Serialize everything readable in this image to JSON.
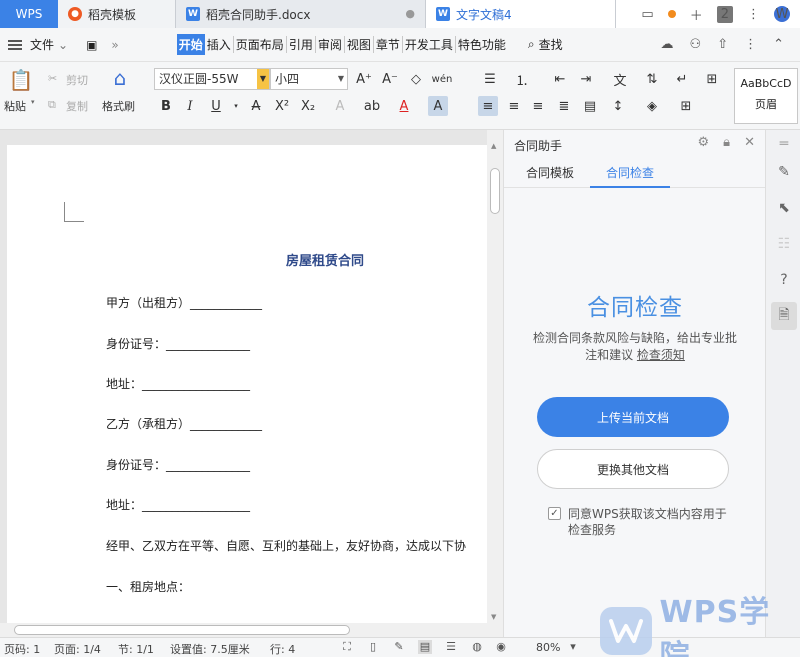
{
  "tabbar": {
    "app": "WPS",
    "tabs": [
      {
        "label": "稻壳模板",
        "icon": "docer-icon"
      },
      {
        "label": "稻壳合同助手.docx",
        "icon": "word-doc-icon"
      },
      {
        "label": "文字文稿4",
        "icon": "word-doc-icon"
      }
    ],
    "window_count": "2"
  },
  "menu": {
    "file": "文件",
    "tabs": [
      "开始",
      "插入",
      "页面布局",
      "引用",
      "审阅",
      "视图",
      "章节",
      "开发工具",
      "特色功能"
    ],
    "search": "查找"
  },
  "ribbon": {
    "paste": "粘贴",
    "cut": "剪切",
    "copy": "复制",
    "format_painter": "格式刷",
    "font_name": "汉仪正圆-55W",
    "font_size": "小四",
    "style_preview": "AaBbCcD",
    "style_name": "页眉"
  },
  "document": {
    "title": "房屋租赁合同",
    "lines": [
      "甲方（出租方）____________",
      "身份证号：______________",
      "地址：__________________",
      "乙方（承租方）____________",
      "身份证号：______________",
      "地址：__________________",
      "经甲、乙双方在平等、自愿、互利的基础上，友好协商，达成以下协",
      "一、租房地点："
    ]
  },
  "panel": {
    "header": "合同助手",
    "tabs": [
      "合同模板",
      "合同检查"
    ],
    "active_tab": "合同检查",
    "heading": "合同检查",
    "description": "检测合同条款风险与缺陷，给出专业批注和建议",
    "link": "检查须知",
    "upload_button": "上传当前文档",
    "other_button": "更换其他文档",
    "agree_text": "同意WPS获取该文档内容用于检查服务",
    "agree_checked": true
  },
  "status": {
    "page_code": "页码: 1",
    "pages": "页面: 1/4",
    "section": "节: 1/1",
    "setting": "设置值: 7.5厘米",
    "row": "行: 4",
    "zoom": "80%"
  },
  "watermark": {
    "text": "WPS学院"
  },
  "colors": {
    "accent": "#3b82e6",
    "heading": "#4a90e2",
    "doc_title": "#2f4a8a"
  }
}
